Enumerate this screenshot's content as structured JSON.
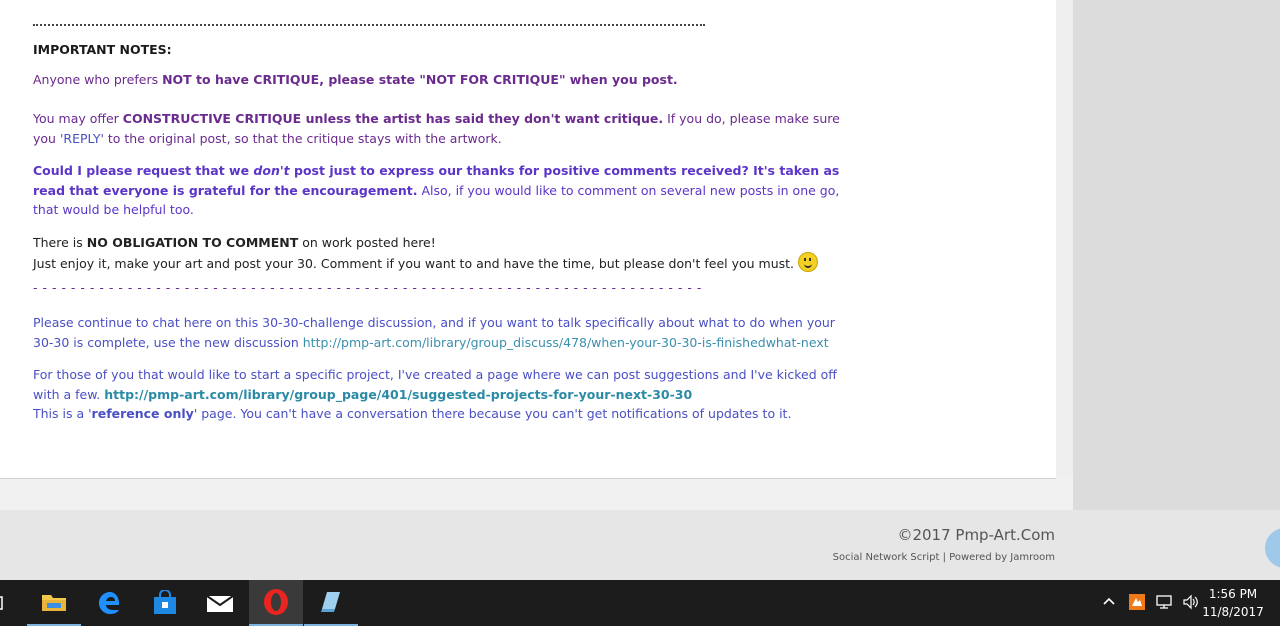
{
  "post": {
    "important_heading": "IMPORTANT NOTES:",
    "p1": {
      "a": "Anyone who prefers ",
      "b": "NOT to have CRITIQUE, please state \"NOT FOR CRITIQUE\" when you post."
    },
    "p2": {
      "a": "You may offer ",
      "b": "CONSTRUCTIVE CRITIQUE unless the artist has said they don't want critique.",
      "c": "  If you do, please make sure you ",
      "d": "'REPLY'",
      "e": " to the original post, so that the critique stays with the artwork."
    },
    "p3": {
      "a": "Could I please request that we ",
      "b": "don't",
      "c": " post just to express our thanks for positive comments received?  It's taken as read that everyone is grateful for the encouragement.",
      "d": "  Also, if you would like to comment on several new posts in one go, that would be helpful too."
    },
    "p4": {
      "a": "There is ",
      "b": "NO OBLIGATION TO COMMENT",
      "c": " on work posted here!",
      "d": "Just enjoy it, make your art and post your 30.  Comment if you want to and have the time, but please don't feel you must."
    },
    "dash_rule": "- - - - - - - - - - - - - - - - - - - - - - - - - - - - - - - - - - - - - - - - - - - - - - - - - - - - - - - - - - - - - - - - - - - - - - - - - - - - - - - - - - - - - - - -",
    "p5": {
      "a": "Please continue to chat here on this 30-30-challenge discussion, and if you want to talk specifically about what to do when your 30-30 is complete, use the new discussion ",
      "link": "http://pmp-art.com/library/group_discuss/478/when-your-30-30-is-finishedwhat-next"
    },
    "p6": {
      "a": "For those of you that would like to start a specific project, I've created a page where we can post suggestions and I've kicked off with a few.  ",
      "link": "http://pmp-art.com/library/group_page/401/suggested-projects-for-your-next-30-30",
      "b": "This is a '",
      "c": "reference only",
      "d": "' page.  You can't have a conversation there because you can't get notifications of updates to it."
    }
  },
  "footer": {
    "copyright": "©2017 Pmp-Art.Com",
    "powered": "Social Network Script | Powered by Jamroom"
  },
  "taskbar": {
    "clock_time": "1:56 PM",
    "clock_date": "11/8/2017"
  },
  "colors": {
    "accent_purple": "#6a2a8e",
    "link_blue": "#3b8fae",
    "taskbar": "#1c1c1c"
  }
}
